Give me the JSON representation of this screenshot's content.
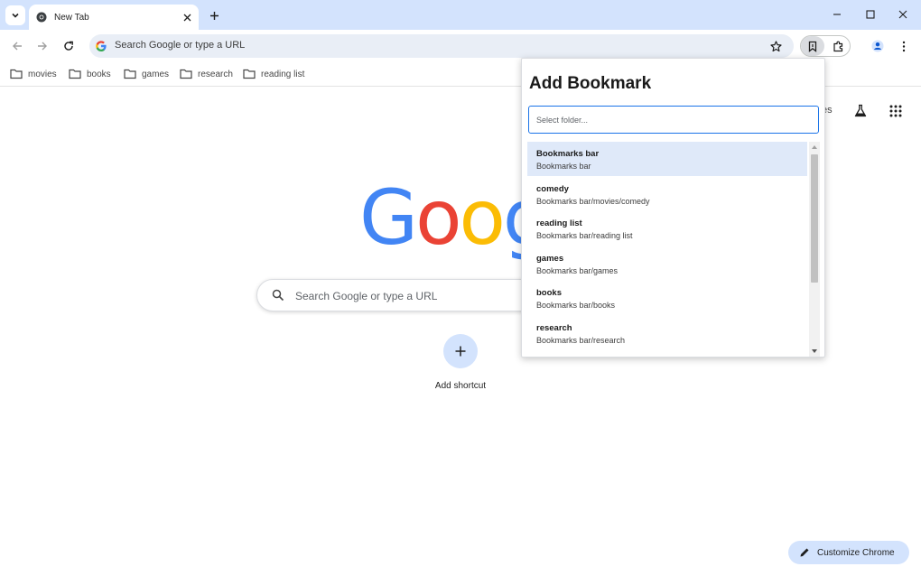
{
  "tabs": [
    {
      "title": "New Tab"
    }
  ],
  "omnibox": {
    "placeholder": "Search Google or type a URL"
  },
  "bookmarks_bar": [
    {
      "label": "movies"
    },
    {
      "label": "books"
    },
    {
      "label": "games"
    },
    {
      "label": "research"
    },
    {
      "label": "reading list"
    }
  ],
  "ntp": {
    "logo_letters": [
      "G",
      "o",
      "o",
      "g"
    ],
    "logo_colors": [
      "#4285f4",
      "#ea4335",
      "#fbbc05",
      "#4285f4"
    ],
    "partial_label": "es",
    "search_placeholder": "Search Google or type a URL",
    "shortcut_label": "Add shortcut",
    "customize_label": "Customize Chrome"
  },
  "popup": {
    "title": "Add Bookmark",
    "input_placeholder": "Select folder...",
    "folders": [
      {
        "name": "Bookmarks bar",
        "path": "Bookmarks bar",
        "selected": true
      },
      {
        "name": "comedy",
        "path": "Bookmarks bar/movies/comedy",
        "selected": false
      },
      {
        "name": "reading list",
        "path": "Bookmarks bar/reading list",
        "selected": false
      },
      {
        "name": "games",
        "path": "Bookmarks bar/games",
        "selected": false
      },
      {
        "name": "books",
        "path": "Bookmarks bar/books",
        "selected": false
      },
      {
        "name": "research",
        "path": "Bookmarks bar/research",
        "selected": false
      }
    ]
  },
  "colors": {
    "accent": "#1a73e8",
    "tabstrip": "#d3e3fd",
    "selected_row": "#dfe9f9"
  },
  "icons": [
    "chevron-down-icon",
    "chrome-icon",
    "close-icon",
    "plus-icon",
    "minimize-icon",
    "maximize-icon",
    "back-icon",
    "forward-icon",
    "reload-icon",
    "google-g-icon",
    "star-icon",
    "bookmark-extension-icon",
    "puzzle-icon",
    "profile-icon",
    "kebab-menu-icon",
    "folder-icon",
    "flask-icon",
    "apps-grid-icon",
    "search-icon",
    "pencil-icon"
  ]
}
